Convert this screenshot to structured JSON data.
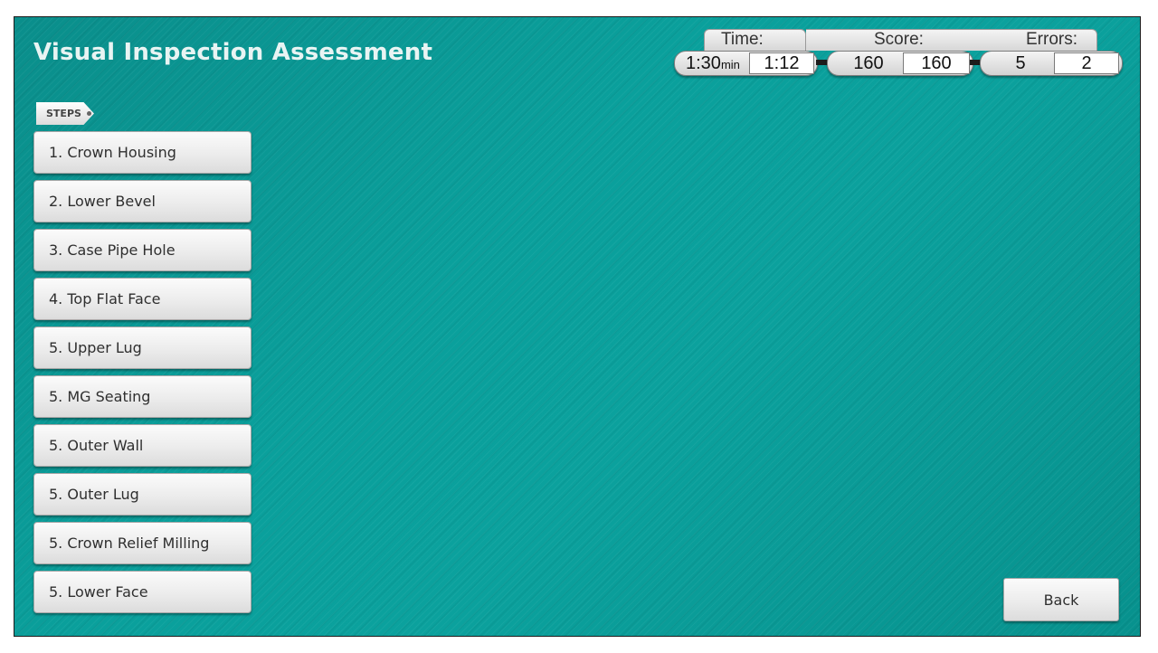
{
  "header": {
    "title": "Visual Inspection Assessment"
  },
  "stats": {
    "time": {
      "label": "Time:",
      "limit": "1:30",
      "limit_unit": "min",
      "value": "1:12"
    },
    "score": {
      "label": "Score:",
      "max": "160",
      "value": "160"
    },
    "errors": {
      "label": "Errors:",
      "max": "5",
      "value": "2"
    }
  },
  "steps": {
    "tag_label": "STEPS",
    "items": [
      {
        "label": "1. Crown Housing"
      },
      {
        "label": "2. Lower Bevel"
      },
      {
        "label": "3. Case Pipe Hole"
      },
      {
        "label": "4. Top Flat Face"
      },
      {
        "label": "5. Upper Lug"
      },
      {
        "label": "5. MG Seating"
      },
      {
        "label": "5. Outer Wall"
      },
      {
        "label": "5. Outer Lug"
      },
      {
        "label": "5. Crown Relief Milling"
      },
      {
        "label": "5. Lower Face"
      }
    ]
  },
  "footer": {
    "back_label": "Back"
  },
  "colors": {
    "background": "#0a9b97",
    "title_text": "#e8f4f3",
    "button_face": "#ececec"
  }
}
